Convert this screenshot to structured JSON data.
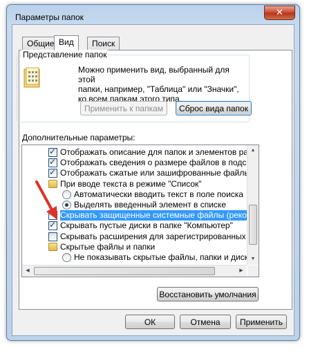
{
  "window": {
    "title": "Параметры папок",
    "close": "✕"
  },
  "tabs": [
    {
      "label": "Общие"
    },
    {
      "label": "Вид"
    },
    {
      "label": "Поиск"
    }
  ],
  "folder_view": {
    "group_label": "Представление папок",
    "description_lines": [
      "Можно применить вид, выбранный для этой",
      "папки, например, \"Таблица\" или \"Значки\",",
      "ко всем папкам этого типа."
    ],
    "apply_button": "Применить к папкам",
    "reset_button": "Сброс вида папок"
  },
  "advanced": {
    "label": "Дополнительные параметры:",
    "items": [
      {
        "kind": "checkbox",
        "checked": true,
        "indent": 1,
        "text": "Отображать описание для папок и элементов рабоче"
      },
      {
        "kind": "checkbox",
        "checked": true,
        "indent": 1,
        "text": "Отображать сведения о размере файлов в подсказк"
      },
      {
        "kind": "checkbox",
        "checked": true,
        "indent": 1,
        "text": "Отображать сжатые или зашифрованные файлы NTI"
      },
      {
        "kind": "folder",
        "checked": false,
        "indent": 1,
        "text": "При вводе текста в режиме \"Список\""
      },
      {
        "kind": "radio",
        "checked": false,
        "indent": 2,
        "text": "Автоматически вводить текст в поле поиска"
      },
      {
        "kind": "radio",
        "checked": true,
        "indent": 2,
        "text": "Выделять введенный элемент в списке"
      },
      {
        "kind": "checkbox",
        "checked": false,
        "indent": 1,
        "selected": true,
        "text": "Скрывать защищенные системные файлы (рекомен"
      },
      {
        "kind": "checkbox",
        "checked": true,
        "indent": 1,
        "text": "Скрывать пустые диски в папке \"Компьютер\""
      },
      {
        "kind": "checkbox",
        "checked": false,
        "indent": 1,
        "text": "Скрывать расширения для зарегистрированных типо"
      },
      {
        "kind": "folder",
        "checked": false,
        "indent": 1,
        "text": "Скрытые файлы и папки"
      },
      {
        "kind": "radio",
        "checked": false,
        "indent": 2,
        "text": "Не показывать скрытые файлы, папки и диски"
      }
    ],
    "restore_button": "Восстановить умолчания"
  },
  "footer": {
    "ok": "ОК",
    "cancel": "Отмена",
    "apply": "Применить"
  },
  "colors": {
    "selection": "#3399ff",
    "annotation_arrow": "#e0312a"
  }
}
